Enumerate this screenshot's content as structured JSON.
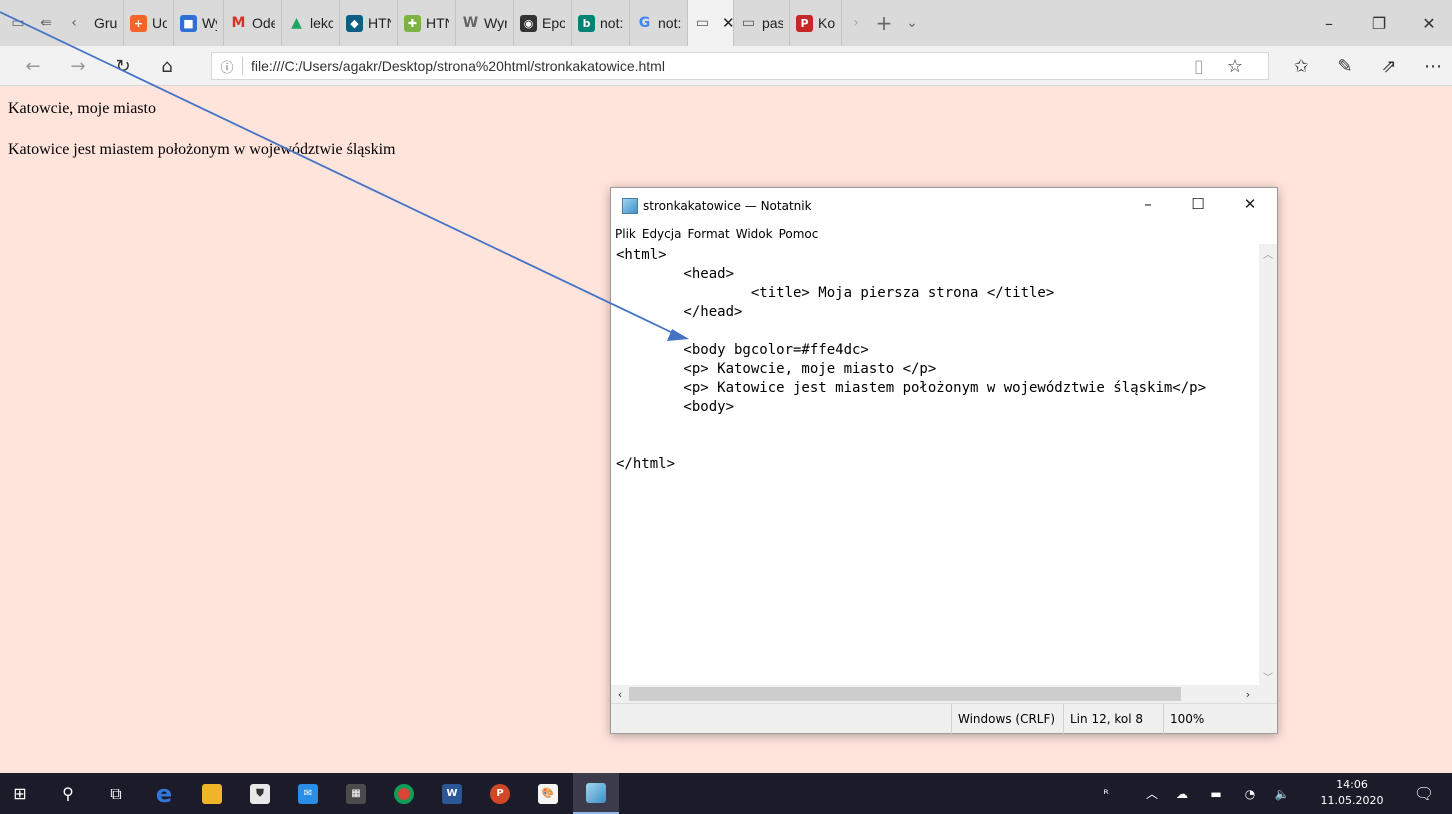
{
  "browser": {
    "tabs": [
      {
        "label": "Gru|",
        "icon": "generic-tab-icon",
        "color": "#dadada"
      },
      {
        "label": "Uon",
        "icon": "plus-tile-icon",
        "color": "#f2662a"
      },
      {
        "label": "Wyr",
        "icon": "person-tile-icon",
        "color": "#2d6fd8"
      },
      {
        "label": "Ode",
        "icon": "gmail-icon",
        "color": "#d93025"
      },
      {
        "label": "lekc",
        "icon": "google-drive-icon",
        "color": "#1fa463"
      },
      {
        "label": "HTN",
        "icon": "graduation-cap-icon",
        "color": "#0b5f84"
      },
      {
        "label": "HTN",
        "icon": "puzzle-icon",
        "color": "#7cb342"
      },
      {
        "label": "Wyr",
        "icon": "w-letter-icon",
        "color": "#666666"
      },
      {
        "label": "Epo",
        "icon": "camera-icon",
        "color": "#333333"
      },
      {
        "label": "not:",
        "icon": "bing-icon",
        "color": "#008373"
      },
      {
        "label": "not:",
        "icon": "google-icon",
        "color": "#4285f4"
      },
      {
        "label": "",
        "icon": "page-icon",
        "color": "#555555",
        "active": true
      },
      {
        "label": "past",
        "icon": "page-icon",
        "color": "#555555"
      },
      {
        "label": "Kolc",
        "icon": "pdf-icon",
        "color": "#c62828"
      }
    ],
    "tab_close_symbol": "✕",
    "new_tab_symbol": "+",
    "url": "file:///C:/Users/agakr/Desktop/strona%20html/stronkakatowice.html"
  },
  "page": {
    "paragraph1": "Katowcie, moje miasto",
    "paragraph2": "Katowice jest miastem położonym w województwie śląskim",
    "background": "#ffe4dc"
  },
  "notepad": {
    "title": "stronkakatowice — Notatnik",
    "menu": [
      "Plik",
      "Edycja",
      "Format",
      "Widok",
      "Pomoc"
    ],
    "code": "<html>\n        <head>\n                <title> Moja piersza strona </title>\n        </head>\n\n        <body bgcolor=#ffe4dc>\n        <p> Katowcie, moje miasto </p>\n        <p> Katowice jest miastem położonym w województwie śląskim</p>\n        <body>\n\n\n</html>",
    "status": {
      "encoding": "Windows (CRLF)",
      "position": "Lin 12, kol 8",
      "zoom": "100%"
    }
  },
  "taskbar": {
    "time": "14:06",
    "date": "11.05.2020"
  },
  "colors": {
    "annotation_arrow": "#4472c4",
    "taskbar": "#1b1b2a"
  }
}
